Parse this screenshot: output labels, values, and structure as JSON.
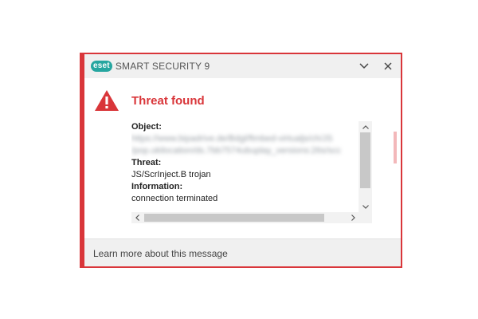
{
  "window": {
    "brand_badge": "eset",
    "product_name": "SMART SECURITY 9",
    "minimize_icon": "chevron-down-icon",
    "close_icon": "close-icon"
  },
  "alert": {
    "icon": "warning-triangle-icon",
    "heading": "Threat found",
    "accent_color": "#d9363a",
    "lines": [
      {
        "text": "Object:",
        "style": "bold"
      },
      {
        "text": "https://www.bipadrive.de/Bdgl/ftmbed-virtualjs/ch/JS",
        "style": "blur"
      },
      {
        "text": "/pop.ukilocation/ds.7bb7574ubuplay_versions:26s/scc",
        "style": "blur"
      },
      {
        "text": "Threat:",
        "style": "bold"
      },
      {
        "text": "JS/ScrInject.B trojan",
        "style": "normal"
      },
      {
        "text": "Information:",
        "style": "bold"
      },
      {
        "text": "connection terminated",
        "style": "normal"
      }
    ]
  },
  "footer": {
    "link_text": "Learn more about this message"
  }
}
